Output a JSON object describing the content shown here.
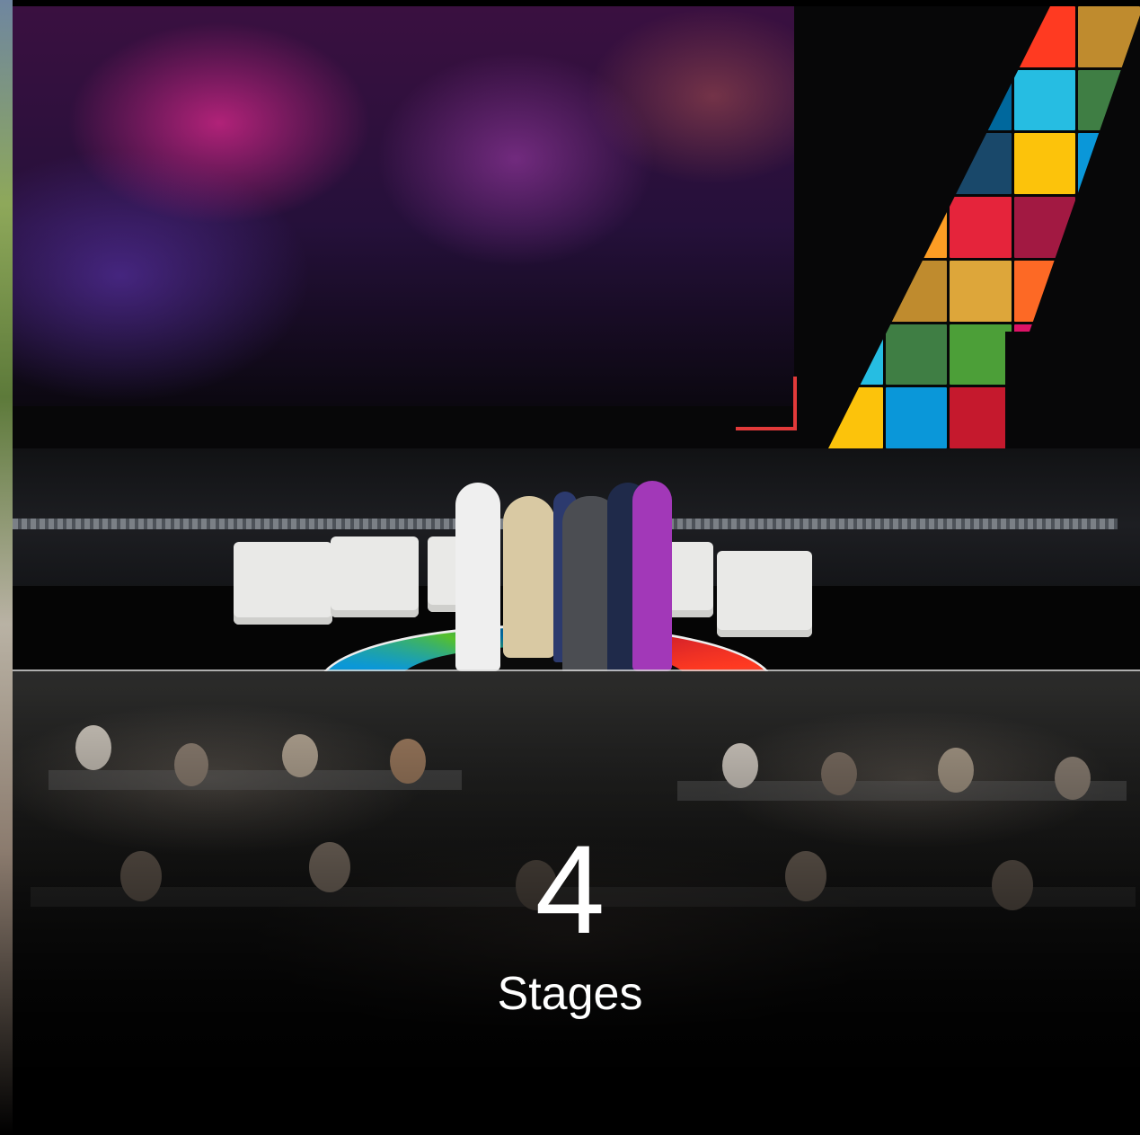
{
  "stat": {
    "number": "4",
    "label": "Stages"
  },
  "palette": {
    "accent_bracket": "#e23a3a",
    "sdg_colors": [
      "#e5243b",
      "#dda63a",
      "#4c9f38",
      "#c5192d",
      "#ff3a21",
      "#26bde2",
      "#fcc30b",
      "#a21942",
      "#fd6925",
      "#dd1367",
      "#fd9d24",
      "#bf8b2e",
      "#3f7e44",
      "#0a97d9",
      "#56c02b",
      "#00689d",
      "#19486a"
    ]
  }
}
